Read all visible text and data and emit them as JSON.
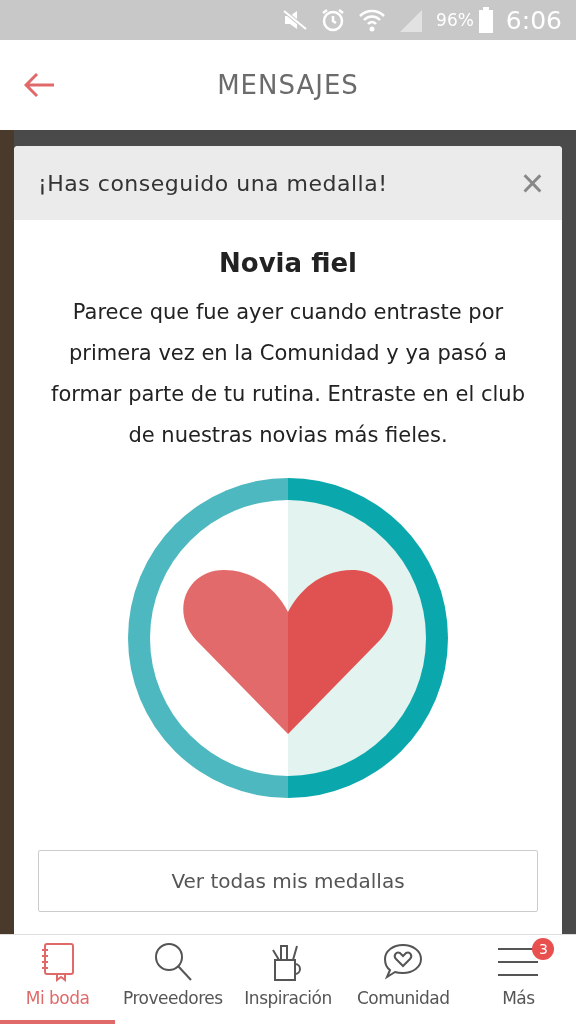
{
  "status_bar": {
    "battery": "96%",
    "time": "6:06"
  },
  "header": {
    "title": "MENSAJES"
  },
  "dialog": {
    "heading": "¡Has conseguido una medalla!",
    "close": "×",
    "medal_title": "Novia fiel",
    "description": "Parece que fue ayer cuando entraste por primera vez en la Comunidad y ya pasó a formar parte de tu rutina. Entraste en el club de nuestras novias más fieles.",
    "button": "Ver todas mis medallas"
  },
  "tabs": [
    {
      "label": "Mi boda",
      "selected": true
    },
    {
      "label": "Proveedores",
      "selected": false
    },
    {
      "label": "Inspiración",
      "selected": false
    },
    {
      "label": "Comunidad",
      "selected": false
    },
    {
      "label": "Más",
      "badge": "3",
      "selected": false
    }
  ]
}
